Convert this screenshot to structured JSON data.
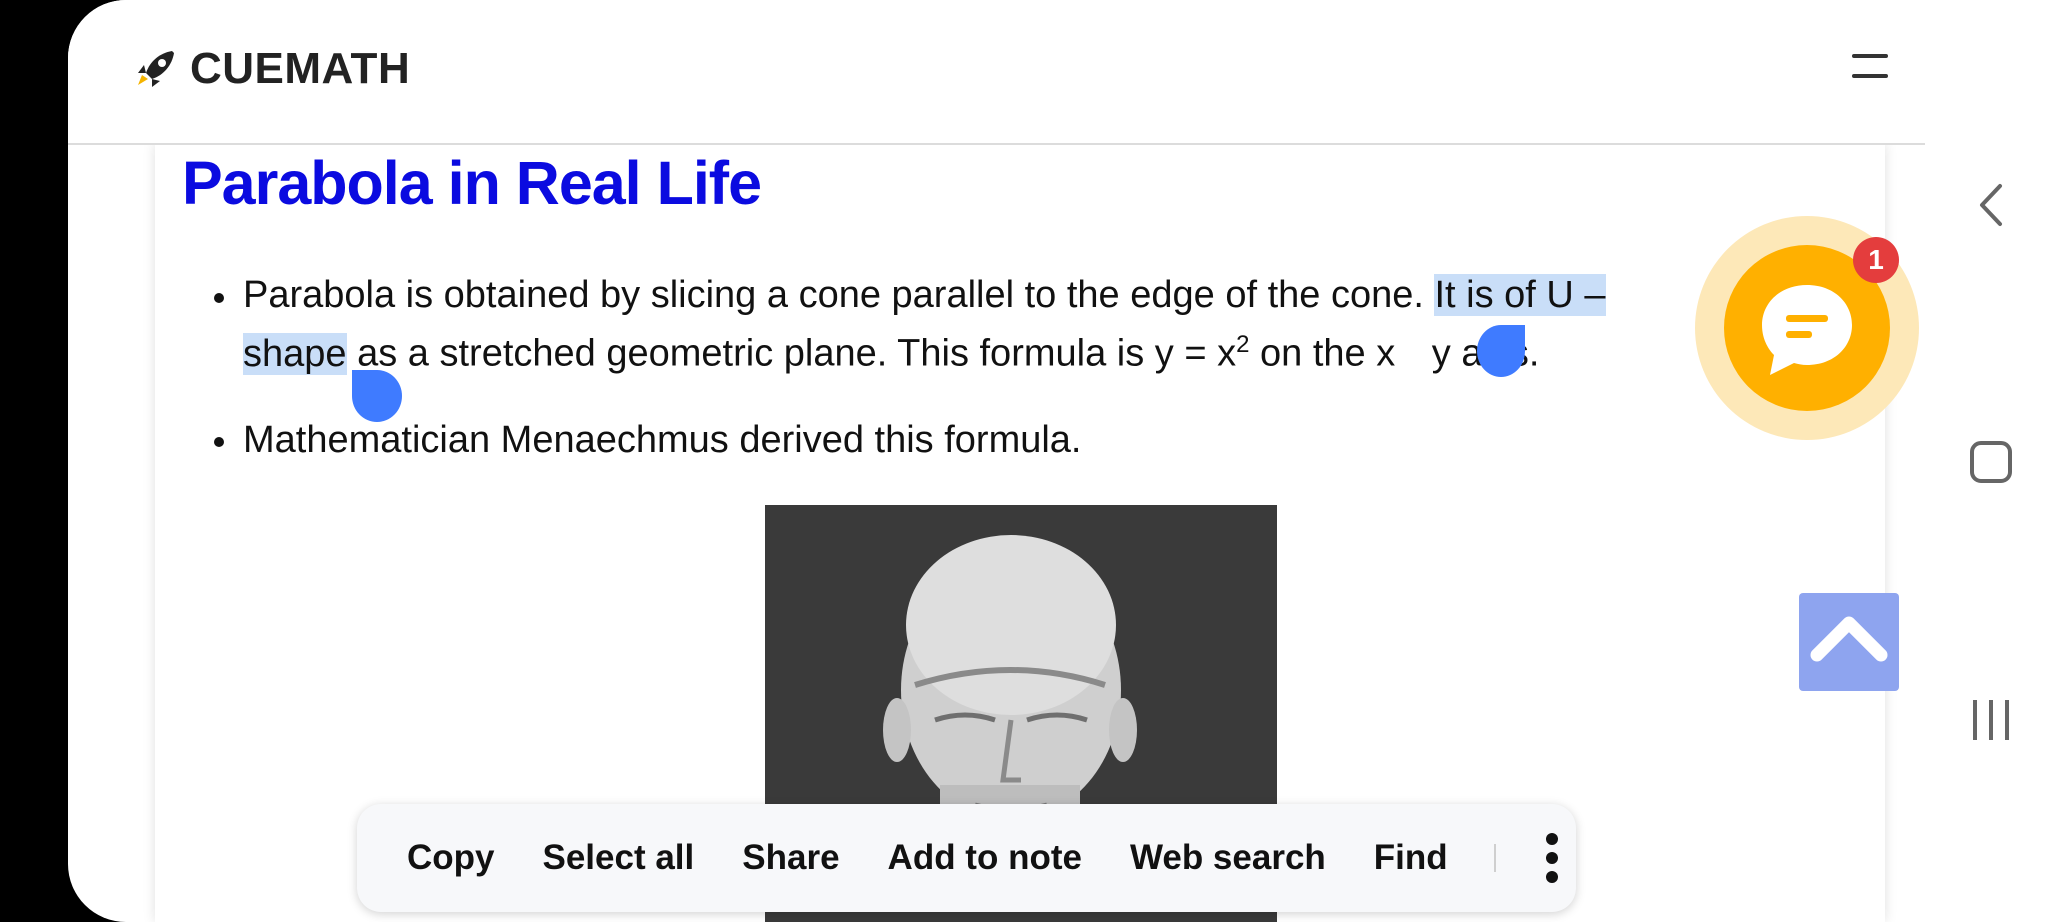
{
  "header": {
    "logo_text": "CUEMATH",
    "logo_icon": "rocket-icon",
    "menu_icon": "menu-icon"
  },
  "article": {
    "title": "Parabola in Real Life",
    "bullet1": {
      "line1_a": "Parabola is obtained by slicing a cone parallel to the edge of the cone. ",
      "line1_highlight": "It is of U –",
      "line2_highlight": "shape",
      "line2_a": " as a stretched geometric plane. This formula is y = x",
      "line2_sup": "2",
      "line2_b": " on the x",
      "line2_c": " y axis."
    },
    "bullet2": "Mathematician Menaechmus derived this formula.",
    "image_alt": "Menaechmus bust"
  },
  "chat_widget": {
    "badge_count": "1",
    "icon": "chat-icon"
  },
  "scroll_top_icon": "chevron-up-icon",
  "system_nav": {
    "back_icon": "back-chevron-icon",
    "home_icon": "home-square-icon",
    "recents_icon": "recents-icon"
  },
  "selection_toolbar": {
    "copy": "Copy",
    "select_all": "Select all",
    "share": "Share",
    "add_to_note": "Add to note",
    "web_search": "Web search",
    "find": "Find",
    "more_icon": "more-vertical-icon"
  },
  "colors": {
    "title": "#0b0be0",
    "highlight": "#c9def8",
    "handle": "#3f7bff",
    "chat": "#ffb000",
    "badge": "#e43d3d",
    "scroll_top": "#8ea4ef"
  }
}
